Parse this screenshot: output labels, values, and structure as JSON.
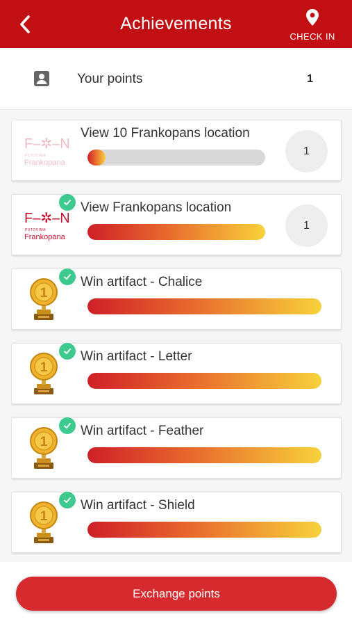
{
  "header": {
    "title": "Achievements",
    "back_icon": "arrow-left-icon",
    "checkin_icon": "map-pin-icon",
    "checkin_label": "CHECK IN",
    "color": "#c10f13"
  },
  "points": {
    "icon": "account-box-icon",
    "label": "Your points",
    "value": "1"
  },
  "achievements": [
    {
      "title": "View 10 Frankopans location",
      "progress": 0.1,
      "completed": false,
      "badge": "1",
      "image": "frankopan-logo-faded"
    },
    {
      "title": "View Frankopans location",
      "progress": 1.0,
      "completed": true,
      "badge": "1",
      "image": "frankopan-logo"
    },
    {
      "title": "Win artifact - Chalice",
      "progress": 1.0,
      "completed": true,
      "image": "trophy-icon"
    },
    {
      "title": "Win artifact - Letter",
      "progress": 1.0,
      "completed": true,
      "image": "trophy-icon"
    },
    {
      "title": "Win artifact - Feather",
      "progress": 1.0,
      "completed": true,
      "image": "trophy-icon"
    },
    {
      "title": "Win artifact - Shield",
      "progress": 1.0,
      "completed": true,
      "image": "trophy-icon"
    }
  ],
  "logo": {
    "mark": "F–✲–N",
    "subtitle": "PUTOVIMA",
    "name": "Frankopana"
  },
  "footer": {
    "button_label": "Exchange points"
  }
}
